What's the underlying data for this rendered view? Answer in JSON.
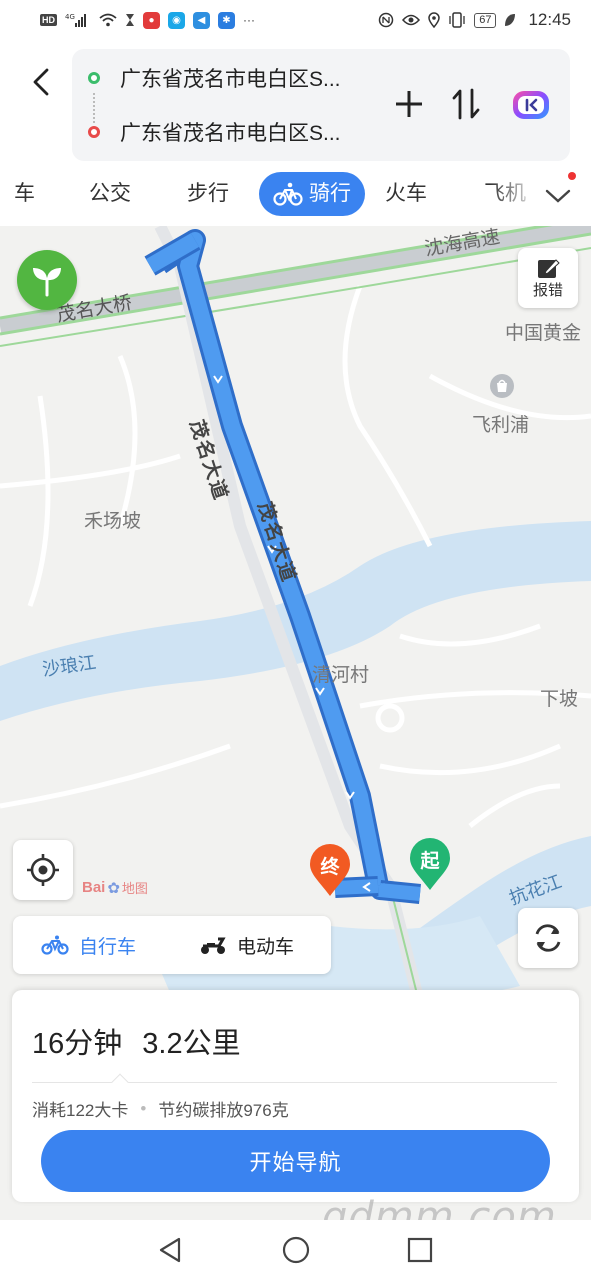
{
  "status_bar": {
    "network": "4G",
    "battery": "67",
    "time": "12:45"
  },
  "route": {
    "origin": "广东省茂名市电白区S...",
    "destination": "广东省茂名市电白区S..."
  },
  "tabs": [
    {
      "label": "车"
    },
    {
      "label": "公交"
    },
    {
      "label": "步行"
    },
    {
      "label": "骑行"
    },
    {
      "label": "火车"
    },
    {
      "label": "飞机"
    }
  ],
  "map": {
    "labels": {
      "highway": "沈海高速",
      "bridge": "茂名大桥",
      "avenue1": "茂名大道",
      "avenue2": "茂名大道",
      "gold": "中国黄金",
      "philips": "飞利浦",
      "hechangpo": "禾场坡",
      "river1": "沙琅江",
      "qinghe": "清河村",
      "xiapo": "下坡",
      "river2": "抗花江"
    },
    "report_label": "报错",
    "start_pin": "起",
    "end_pin": "终",
    "baidu_logo": "Bai",
    "baidu_logo_cn": "地图"
  },
  "modes": {
    "bike": "自行车",
    "ebike": "电动车"
  },
  "summary": {
    "duration": "16分钟",
    "distance": "3.2公里",
    "calories": "消耗122大卡",
    "carbon": "节约碳排放976克",
    "start_button": "开始导航"
  },
  "watermark": "gdmm.com",
  "colors": {
    "accent": "#3a83f0",
    "route": "#4a90e8",
    "start_pin": "#22b573",
    "end_pin": "#f25a22"
  }
}
